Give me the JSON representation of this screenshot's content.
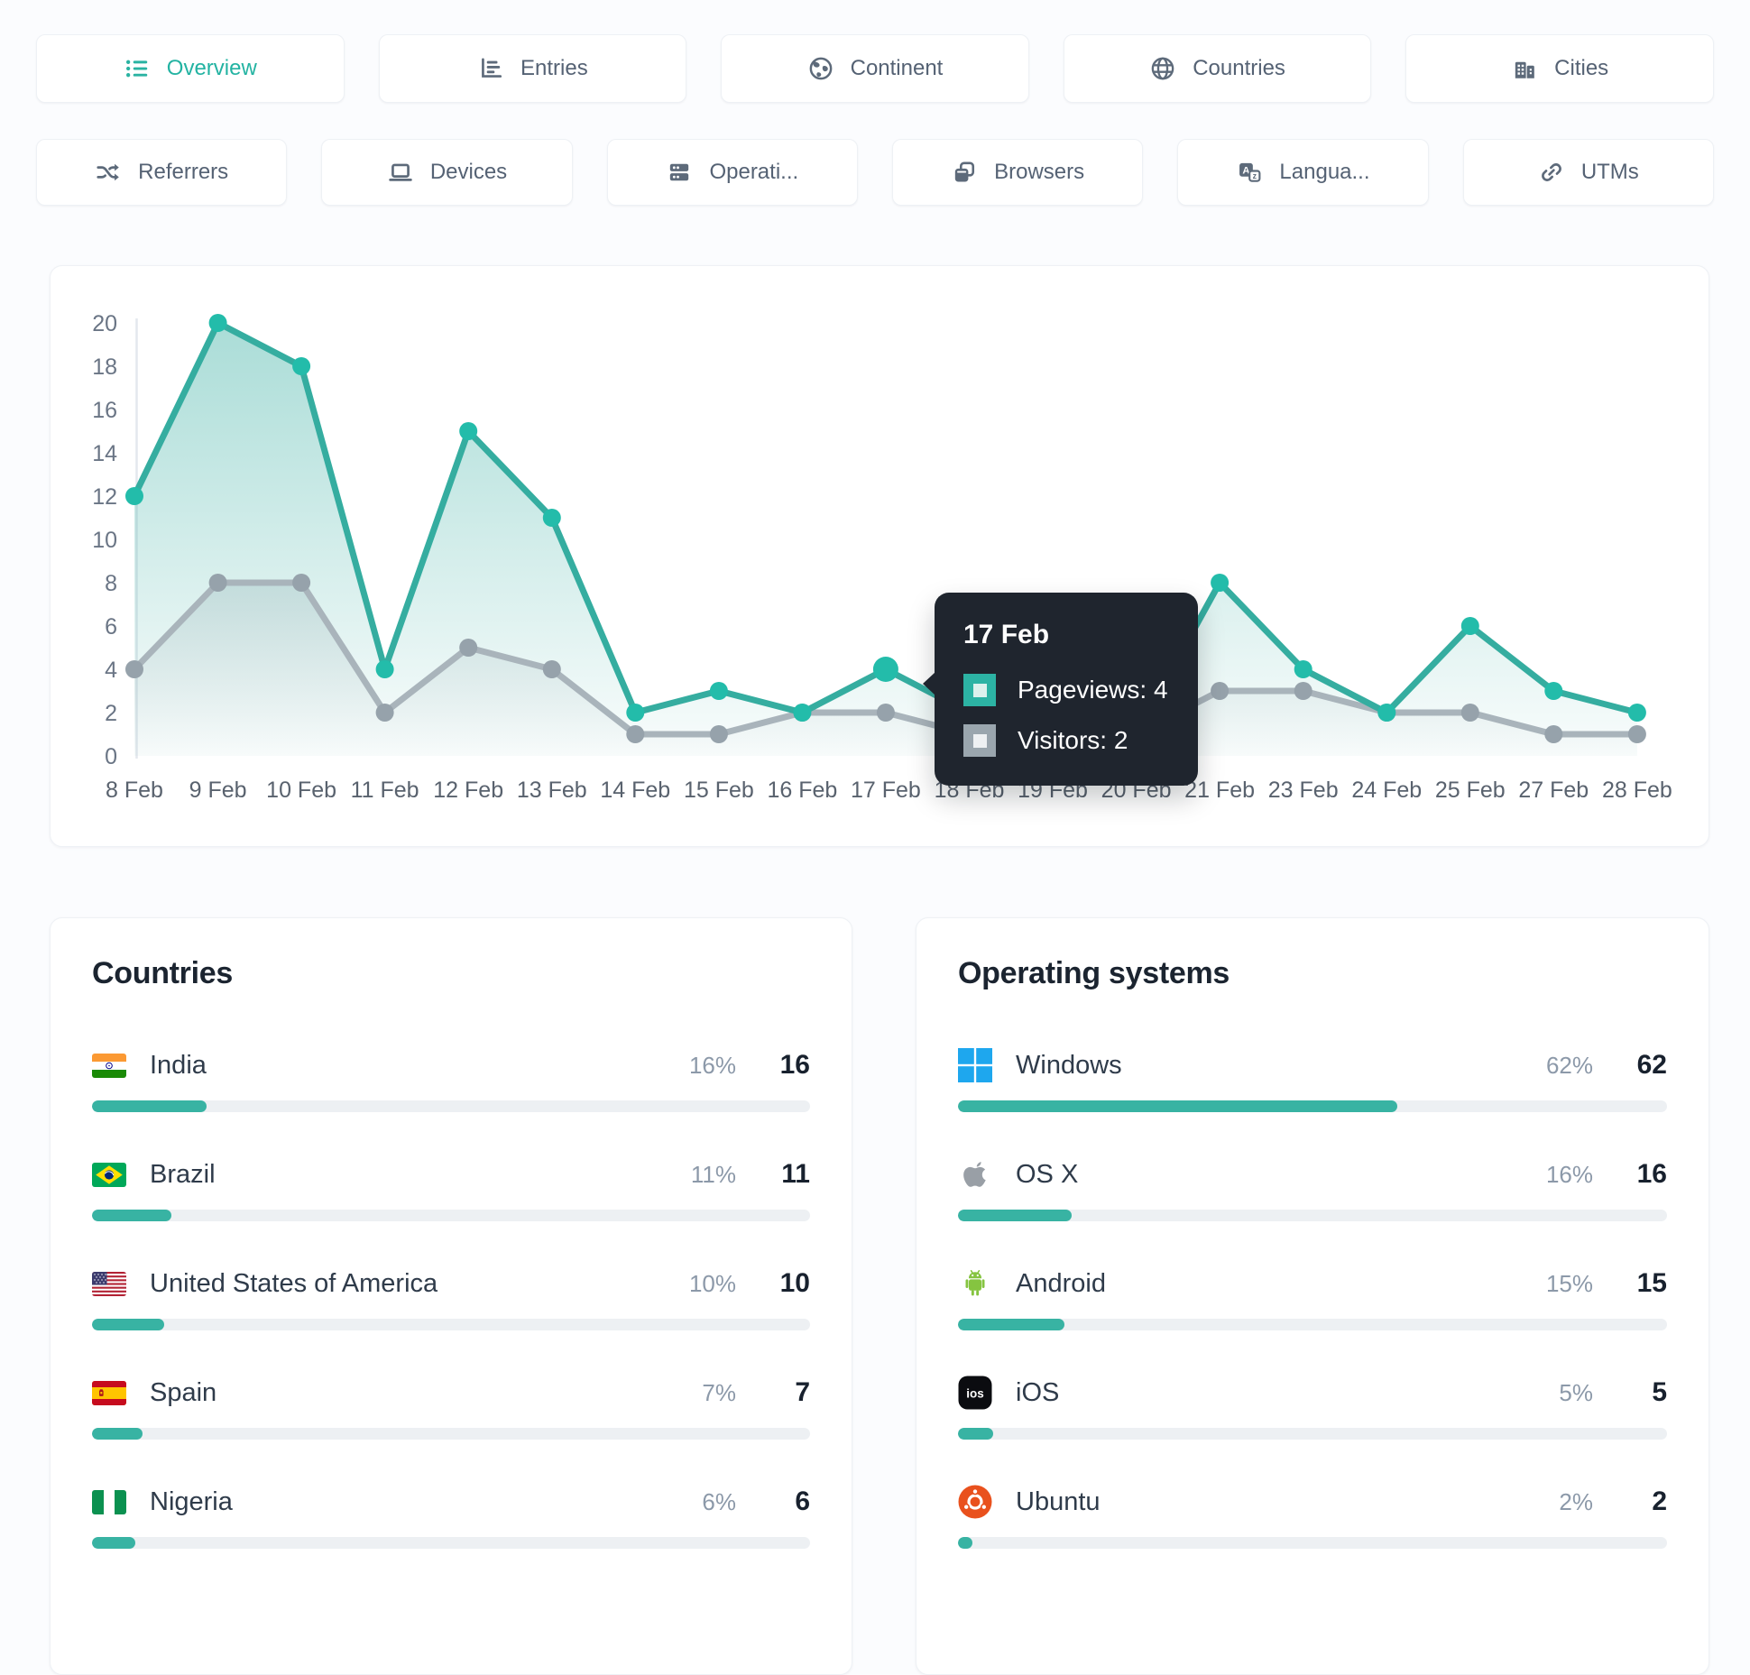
{
  "theme": {
    "accent": "#2ab3a2",
    "pageviews_line": "#35ada0",
    "pageviews_dot": "#23bcaa",
    "visitors_line": "#a9b4bb",
    "visitors_dot": "#96a2ab",
    "bar_fill": "#38b3a3",
    "tooltip_bg": "#1f252e",
    "windows_blue": "#1ea7ee",
    "ubuntu_orange": "#e9511d",
    "android_green": "#85c440"
  },
  "nav": {
    "row1": [
      {
        "id": "overview",
        "icon": "list-icon",
        "label": "Overview",
        "active": true
      },
      {
        "id": "entries",
        "icon": "bar-chart-icon",
        "label": "Entries",
        "active": false
      },
      {
        "id": "continent",
        "icon": "earth-icon",
        "label": "Continent",
        "active": false
      },
      {
        "id": "countries",
        "icon": "globe-icon",
        "label": "Countries",
        "active": false
      },
      {
        "id": "cities",
        "icon": "buildings-icon",
        "label": "Cities",
        "active": false
      }
    ],
    "row2": [
      {
        "id": "referrers",
        "icon": "shuffle-icon",
        "label": "Referrers",
        "active": false
      },
      {
        "id": "devices",
        "icon": "laptop-icon",
        "label": "Devices",
        "active": false
      },
      {
        "id": "operating",
        "icon": "server-icon",
        "label": "Operati...",
        "active": false
      },
      {
        "id": "browsers",
        "icon": "browser-icon",
        "label": "Browsers",
        "active": false
      },
      {
        "id": "languages",
        "icon": "translate-icon",
        "label": "Langua...",
        "active": false
      },
      {
        "id": "utms",
        "icon": "link-icon",
        "label": "UTMs",
        "active": false
      }
    ]
  },
  "chart_data": {
    "type": "area",
    "x_labels": [
      "8 Feb",
      "9 Feb",
      "10 Feb",
      "11 Feb",
      "12 Feb",
      "13 Feb",
      "14 Feb",
      "15 Feb",
      "16 Feb",
      "17 Feb",
      "18 Feb",
      "19 Feb",
      "20 Feb",
      "21 Feb",
      "23 Feb",
      "24 Feb",
      "25 Feb",
      "27 Feb",
      "28 Feb"
    ],
    "y_ticks": [
      0,
      2,
      4,
      6,
      8,
      10,
      12,
      14,
      16,
      18,
      20
    ],
    "ylim": [
      0,
      20
    ],
    "grid": false,
    "series": [
      {
        "name": "Pageviews",
        "line_color": "#35ada0",
        "dot_color": "#23bcaa",
        "values": [
          12,
          20,
          18,
          4,
          15,
          11,
          2,
          3,
          2,
          4,
          2,
          1,
          1,
          8,
          4,
          2,
          6,
          3,
          2
        ]
      },
      {
        "name": "Visitors",
        "line_color": "#a9b4bb",
        "dot_color": "#96a2ab",
        "values": [
          4,
          8,
          8,
          2,
          5,
          4,
          1,
          1,
          2,
          2,
          1,
          1,
          1,
          3,
          3,
          2,
          2,
          1,
          1
        ]
      }
    ],
    "highlight_index": 9
  },
  "tooltip": {
    "date": "17 Feb",
    "items": [
      {
        "text": "Pageviews: 4",
        "swatch": "#2cb3a4",
        "inner": "#dcf1ed"
      },
      {
        "text": "Visitors: 2",
        "swatch": "#9aa6ae",
        "inner": "#eef1f3"
      }
    ]
  },
  "countries_card": {
    "title": "Countries",
    "rows": [
      {
        "icon": "flag-india",
        "name": "India",
        "percent": "16%",
        "count": "16",
        "pct": 16
      },
      {
        "icon": "flag-brazil",
        "name": "Brazil",
        "percent": "11%",
        "count": "11",
        "pct": 11
      },
      {
        "icon": "flag-usa",
        "name": "United States of America",
        "percent": "10%",
        "count": "10",
        "pct": 10
      },
      {
        "icon": "flag-spain",
        "name": "Spain",
        "percent": "7%",
        "count": "7",
        "pct": 7
      },
      {
        "icon": "flag-nigeria",
        "name": "Nigeria",
        "percent": "6%",
        "count": "6",
        "pct": 6
      }
    ]
  },
  "os_card": {
    "title": "Operating systems",
    "rows": [
      {
        "icon": "windows-icon",
        "name": "Windows",
        "percent": "62%",
        "count": "62",
        "pct": 62
      },
      {
        "icon": "apple-icon",
        "name": "OS X",
        "percent": "16%",
        "count": "16",
        "pct": 16
      },
      {
        "icon": "android-icon",
        "name": "Android",
        "percent": "15%",
        "count": "15",
        "pct": 15
      },
      {
        "icon": "ios-icon",
        "name": "iOS",
        "percent": "5%",
        "count": "5",
        "pct": 5
      },
      {
        "icon": "ubuntu-icon",
        "name": "Ubuntu",
        "percent": "2%",
        "count": "2",
        "pct": 2
      }
    ]
  }
}
